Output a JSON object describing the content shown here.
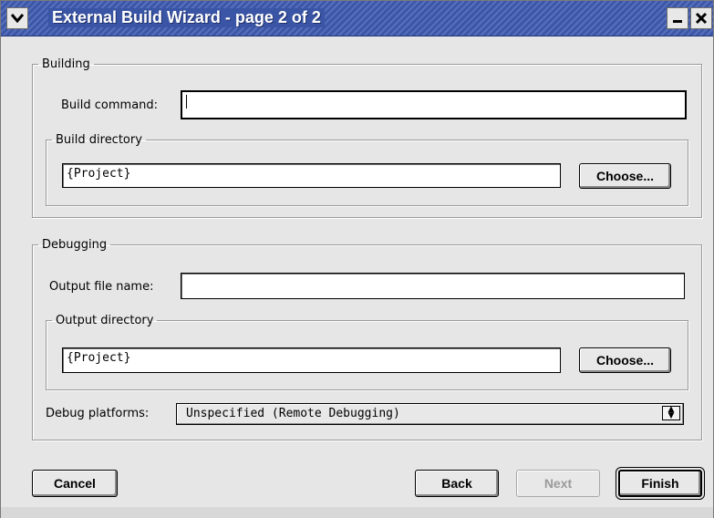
{
  "window": {
    "title": "External Build Wizard - page 2 of 2",
    "title_bar_color": "#3c57a6",
    "menu_icon": "chevron-down-icon",
    "minimize_icon": "minimize-icon",
    "close_icon": "close-icon"
  },
  "building": {
    "legend": "Building",
    "build_command_label": "Build command:",
    "build_command_value": "",
    "build_directory_legend": "Build directory",
    "build_directory_value": "{Project}",
    "choose_label": "Choose..."
  },
  "debugging": {
    "legend": "Debugging",
    "output_file_label": "Output file name:",
    "output_file_value": "",
    "output_directory_legend": "Output directory",
    "output_directory_value": "{Project}",
    "choose_label": "Choose...",
    "debug_platforms_label": "Debug platforms:",
    "debug_platforms_value": "Unspecified (Remote Debugging)"
  },
  "footer": {
    "cancel_label": "Cancel",
    "back_label": "Back",
    "next_label": "Next",
    "finish_label": "Finish"
  }
}
